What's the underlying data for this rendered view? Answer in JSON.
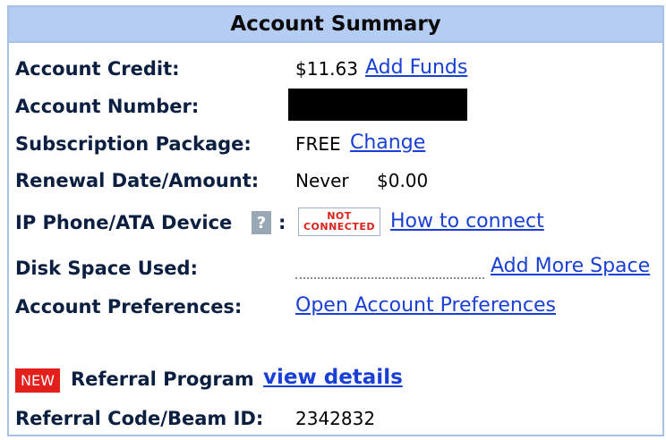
{
  "header": {
    "title": "Account Summary"
  },
  "credit": {
    "label": "Account Credit:",
    "amount": "$11.63",
    "link": "Add Funds"
  },
  "account_number": {
    "label": "Account Number:"
  },
  "subscription": {
    "label": "Subscription Package:",
    "value": "FREE",
    "link": "Change"
  },
  "renewal": {
    "label": "Renewal Date/Amount:",
    "date": "Never",
    "amount": "$0.00"
  },
  "device": {
    "label": "IP Phone/ATA Device",
    "help": "?",
    "colon": ":",
    "status_line1": "NOT",
    "status_line2": "CONNECTED",
    "link": "How to connect"
  },
  "disk": {
    "label": "Disk Space Used:",
    "link": "Add More Space"
  },
  "preferences": {
    "label": "Account Preferences:",
    "link": "Open Account Preferences"
  },
  "referral": {
    "badge": "NEW",
    "label": "Referral Program",
    "link": "view details"
  },
  "referral_code": {
    "label": "Referral Code/Beam ID:",
    "value": "2342832"
  },
  "colors": {
    "header_bg": "#b6cdf3",
    "link": "#1a3fd6",
    "new_badge": "#e3201b",
    "status_text": "#d9231b"
  }
}
